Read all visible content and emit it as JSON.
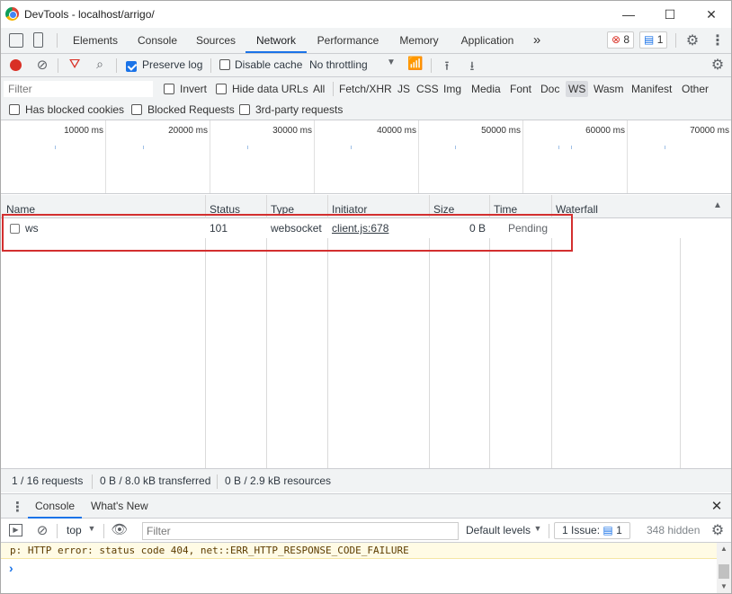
{
  "window": {
    "title": "DevTools - localhost/arrigo/",
    "minimize": "—",
    "maximize": "☐",
    "close": "✕"
  },
  "tabs": [
    "Elements",
    "Console",
    "Sources",
    "Network",
    "Performance",
    "Memory",
    "Application"
  ],
  "more_tabs": "»",
  "badges": {
    "errors": "8",
    "messages": "1"
  },
  "network_toolbar": {
    "preserve_log": "Preserve log",
    "disable_cache": "Disable cache",
    "throttling": "No throttling"
  },
  "filter": {
    "placeholder": "Filter",
    "invert": "Invert",
    "hide_data_urls": "Hide data URLs",
    "types": [
      "All",
      "Fetch/XHR",
      "JS",
      "CSS",
      "Img",
      "Media",
      "Font",
      "Doc",
      "WS",
      "Wasm",
      "Manifest",
      "Other"
    ],
    "selected_type": "WS",
    "has_blocked_cookies": "Has blocked cookies",
    "blocked_requests": "Blocked Requests",
    "third_party": "3rd-party requests"
  },
  "overview": {
    "ticks": [
      "10000 ms",
      "20000 ms",
      "30000 ms",
      "40000 ms",
      "50000 ms",
      "60000 ms",
      "70000 ms"
    ]
  },
  "table": {
    "columns": [
      "Name",
      "Status",
      "Type",
      "Initiator",
      "Size",
      "Time",
      "Waterfall"
    ],
    "rows": [
      {
        "name": "ws",
        "status": "101",
        "type": "websocket",
        "initiator": "client.js:678",
        "size": "0 B",
        "time": "Pending"
      }
    ]
  },
  "status_bar": {
    "requests": "1 / 16 requests",
    "transferred": "0 B / 8.0 kB transferred",
    "resources": "0 B / 2.9 kB resources"
  },
  "drawer": {
    "tabs": [
      "Console",
      "What's New"
    ],
    "context": "top",
    "filter_placeholder": "Filter",
    "levels": "Default levels",
    "issues": "1 Issue:",
    "issues_count": "1",
    "hidden": "348 hidden",
    "error_line": "p: HTTP error: status code 404, net::ERR_HTTP_RESPONSE_CODE_FAILURE",
    "prompt": "›"
  },
  "colors": {
    "accent": "#1a73e8",
    "error": "#d93025",
    "highlight_box": "#d32f2f"
  }
}
